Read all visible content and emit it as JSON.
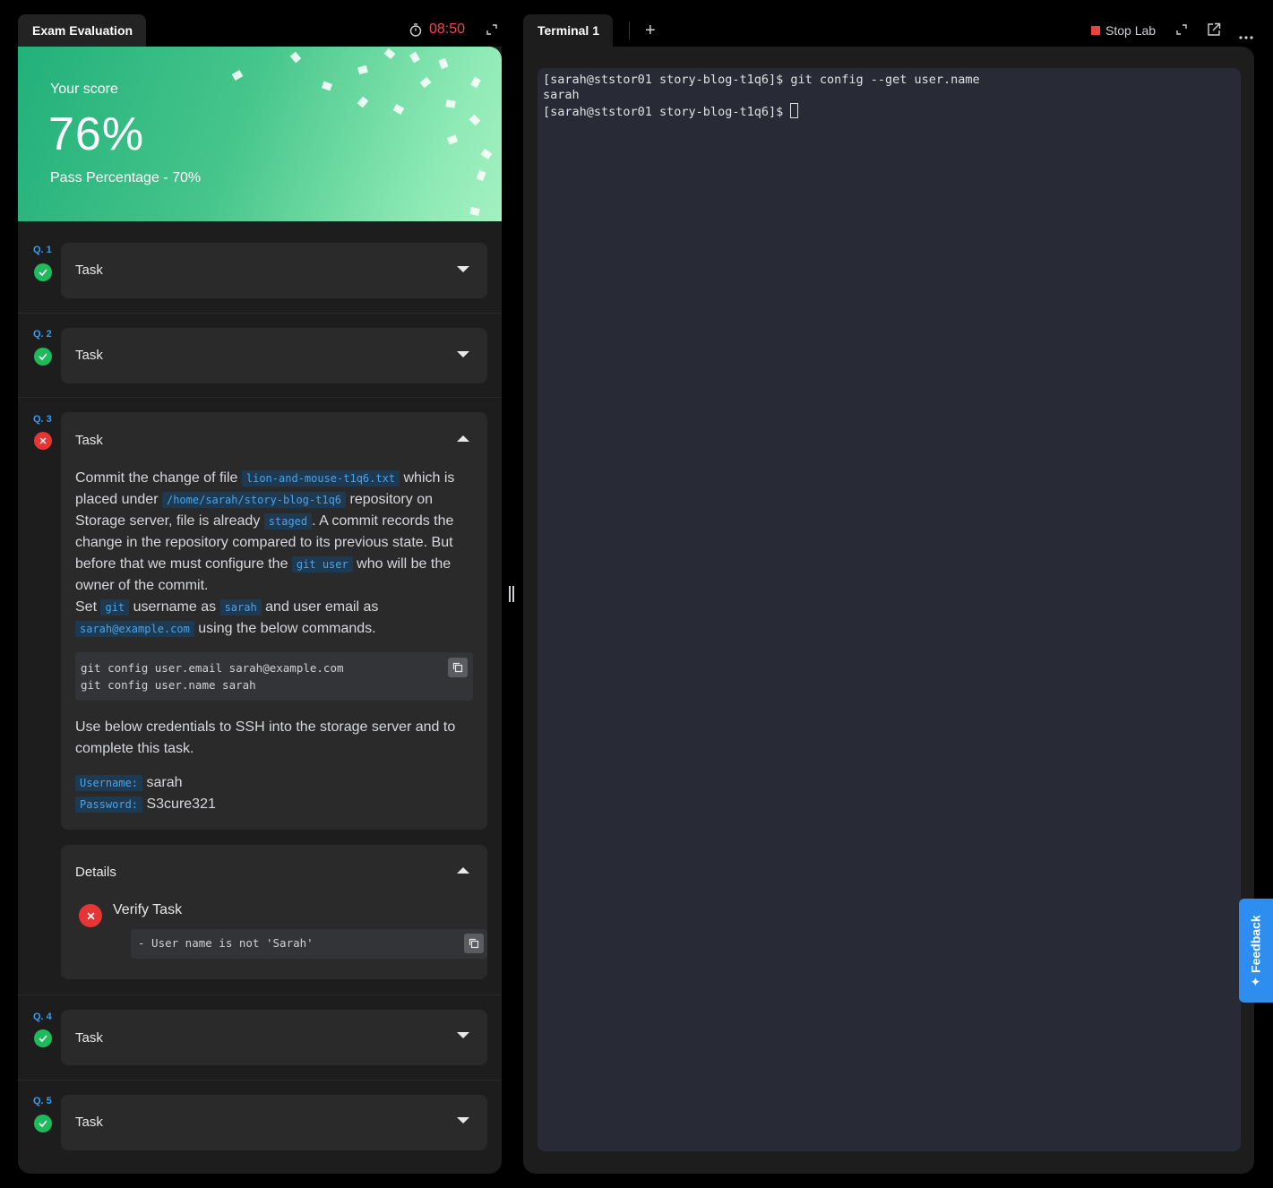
{
  "exam": {
    "tab_label": "Exam Evaluation",
    "timer": "08:50",
    "score_label": "Your score",
    "score_value": "76%",
    "pass_text": "Pass Percentage - 70%"
  },
  "questions": [
    {
      "num": "Q. 1",
      "title": "Task",
      "status": "pass"
    },
    {
      "num": "Q. 2",
      "title": "Task",
      "status": "pass"
    },
    {
      "num": "Q. 3",
      "title": "Task",
      "status": "fail"
    },
    {
      "num": "Q. 4",
      "title": "Task",
      "status": "pass"
    },
    {
      "num": "Q. 5",
      "title": "Task",
      "status": "pass"
    }
  ],
  "task3": {
    "t1": "Commit the change of file",
    "c1": "lion-and-mouse-t1q6.txt",
    "t2": "which is placed under",
    "c2": "/home/sarah/story-blog-t1q6",
    "t3": "repository on Storage server, file is already",
    "c3": "staged",
    "t4": ". A commit records the change in the repository compared to its previous state. But before that we must configure the",
    "c4": "git user",
    "t5": "who will be the owner of the commit.",
    "t6": "Set",
    "c5": "git",
    "t7": "username as",
    "c6": "sarah",
    "t8": "and user email as",
    "c7": "sarah@example.com",
    "t9": "using the below commands.",
    "code_line1": "git config user.email sarah@example.com",
    "code_line2": "git config user.name sarah",
    "ssh_text": "Use below credentials to SSH into the storage server and to complete this task.",
    "user_label": "Username:",
    "user_value": "sarah",
    "pass_label": "Password:",
    "pass_value": "S3cure321"
  },
  "details": {
    "title": "Details",
    "verify_title": "Verify Task",
    "verify_msg": "- User name is not 'Sarah'"
  },
  "terminal": {
    "tab_label": "Terminal 1",
    "add_label": "+",
    "stop_label": "Stop Lab",
    "line1": "[sarah@ststor01 story-blog-t1q6]$ git config --get user.name",
    "line2": "sarah",
    "line3": "[sarah@ststor01 story-blog-t1q6]$ "
  },
  "feedback": {
    "label": "Feedback"
  },
  "colors": {
    "accent": "#3a9bf0",
    "pass": "#1fba5b",
    "fail": "#e53535",
    "timer": "#f0474a"
  }
}
